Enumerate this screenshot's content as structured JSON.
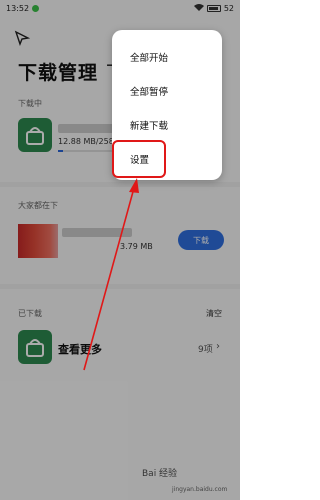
{
  "status": {
    "time": "13:52",
    "battery": "52"
  },
  "header": {
    "title": "下载管理",
    "title_tail": "下"
  },
  "downloading": {
    "label": "下载中",
    "size": "12.88 MB/258",
    "progress_pct": 5
  },
  "recommend": {
    "label": "大家都在下",
    "size": "3.79 MB",
    "button": "下载"
  },
  "downloaded": {
    "label": "已下载",
    "clear": "清空",
    "more": "查看更多",
    "count": "9项"
  },
  "menu": {
    "items": [
      "全部开始",
      "全部暂停",
      "新建下载",
      "设置"
    ]
  },
  "watermark": {
    "main": "Bai 经验",
    "sub": "jingyan.baidu.com"
  },
  "colors": {
    "accent": "#2f6fe0",
    "thumb": "#2e8a4f",
    "highlight": "#e01818"
  }
}
